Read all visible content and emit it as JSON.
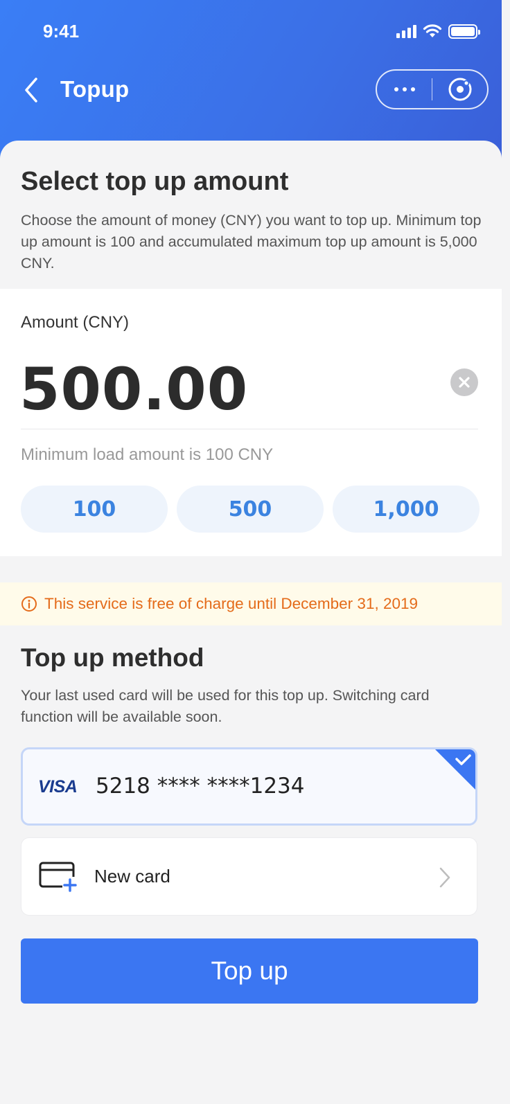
{
  "status_bar": {
    "time": "9:41"
  },
  "nav": {
    "title": "Topup"
  },
  "amount_section": {
    "title": "Select top up amount",
    "description": "Choose the amount of money (CNY) you want to top up. Minimum top up amount is 100 and accumulated maximum top up amount is 5,000 CNY."
  },
  "amount_card": {
    "label": "Amount (CNY)",
    "value": "500.00",
    "hint": "Minimum load amount is 100 CNY",
    "presets": [
      "100",
      "500",
      "1,000"
    ]
  },
  "notice": {
    "text": "This service is free of charge until December 31, 2019"
  },
  "method_section": {
    "title": "Top up method",
    "description": "Your last used card will be used for this top up. Switching card function will be available soon."
  },
  "cards": {
    "selected": {
      "brand": "VISA",
      "number": "5218 **** ****1234"
    },
    "new_card_label": "New card"
  },
  "actions": {
    "topup_label": "Top up"
  },
  "colors": {
    "primary": "#3b76f2",
    "notice_text": "#e46b1a",
    "preset_text": "#3b83e0"
  }
}
